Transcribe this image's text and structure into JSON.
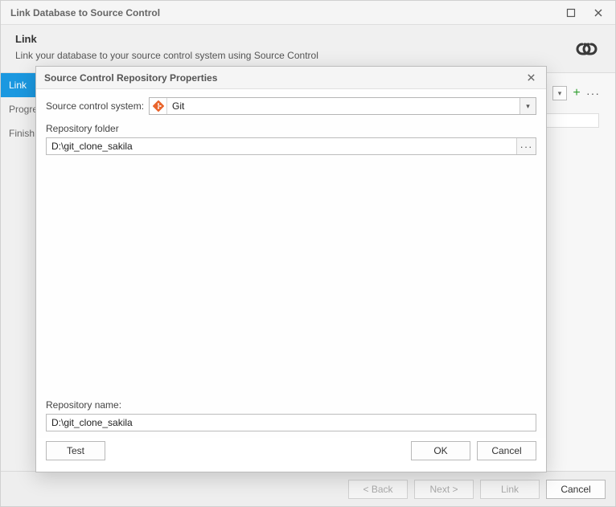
{
  "window": {
    "title": "Link Database to Source Control"
  },
  "header": {
    "title": "Link",
    "subtitle": "Link your database to your source control system using Source Control"
  },
  "sidebar": {
    "steps": [
      "Link",
      "Progress",
      "Finish"
    ],
    "active_index": 0
  },
  "footer": {
    "back": "< Back",
    "next": "Next >",
    "link": "Link",
    "cancel": "Cancel"
  },
  "dialog": {
    "title": "Source Control Repository Properties",
    "scs_label": "Source control system:",
    "scs_value": "Git",
    "repo_folder_label": "Repository folder",
    "repo_folder_value": "D:\\git_clone_sakila",
    "repo_name_label": "Repository name:",
    "repo_name_value": "D:\\git_clone_sakila",
    "test": "Test",
    "ok": "OK",
    "cancel": "Cancel"
  }
}
